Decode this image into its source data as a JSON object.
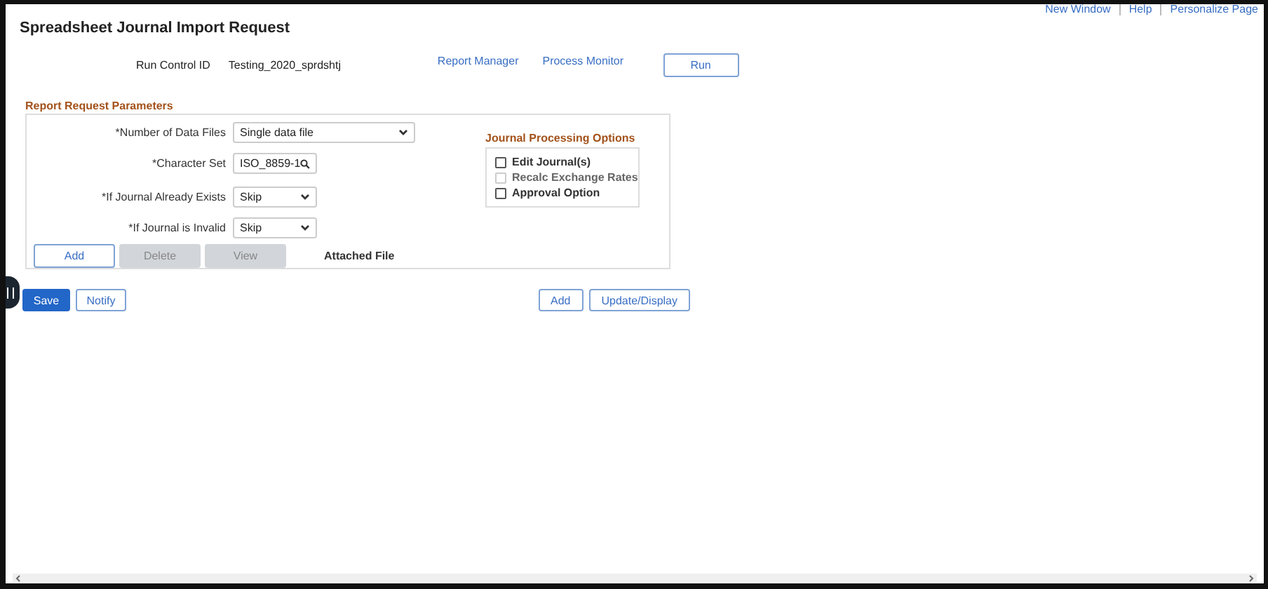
{
  "header_links": [
    "New Window",
    "Help",
    "Personalize Page"
  ],
  "title": "Spreadsheet Journal Import Request",
  "run_control": {
    "label": "Run Control ID",
    "value": "Testing_2020_sprdshtj",
    "links": [
      "Report Manager",
      "Process Monitor"
    ],
    "run_button": "Run"
  },
  "section_title": "Report Request Parameters",
  "fields": [
    {
      "label": "*Number of Data Files",
      "kind": "select",
      "value": "Single data file"
    },
    {
      "label": "*Character Set",
      "kind": "lookup",
      "value": "ISO_8859-1"
    },
    {
      "label": "*If Journal Already Exists",
      "kind": "select",
      "value": "Skip"
    },
    {
      "label": "*If Journal is Invalid",
      "kind": "select",
      "value": "Skip"
    }
  ],
  "file_buttons": [
    {
      "label": "Add",
      "disabled": false
    },
    {
      "label": "Delete",
      "disabled": true
    },
    {
      "label": "View",
      "disabled": true
    }
  ],
  "attached_file_label": "Attached File",
  "options": {
    "title": "Journal Processing Options",
    "items": [
      {
        "label": "Edit Journal(s)",
        "checked": false,
        "disabled": false
      },
      {
        "label": "Recalc Exchange Rates",
        "checked": false,
        "disabled": true
      },
      {
        "label": "Approval Option",
        "checked": false,
        "disabled": false
      }
    ]
  },
  "footer_left": [
    {
      "label": "Save",
      "primary": true
    },
    {
      "label": "Notify",
      "primary": false
    }
  ],
  "footer_right": [
    "Add",
    "Update/Display"
  ]
}
